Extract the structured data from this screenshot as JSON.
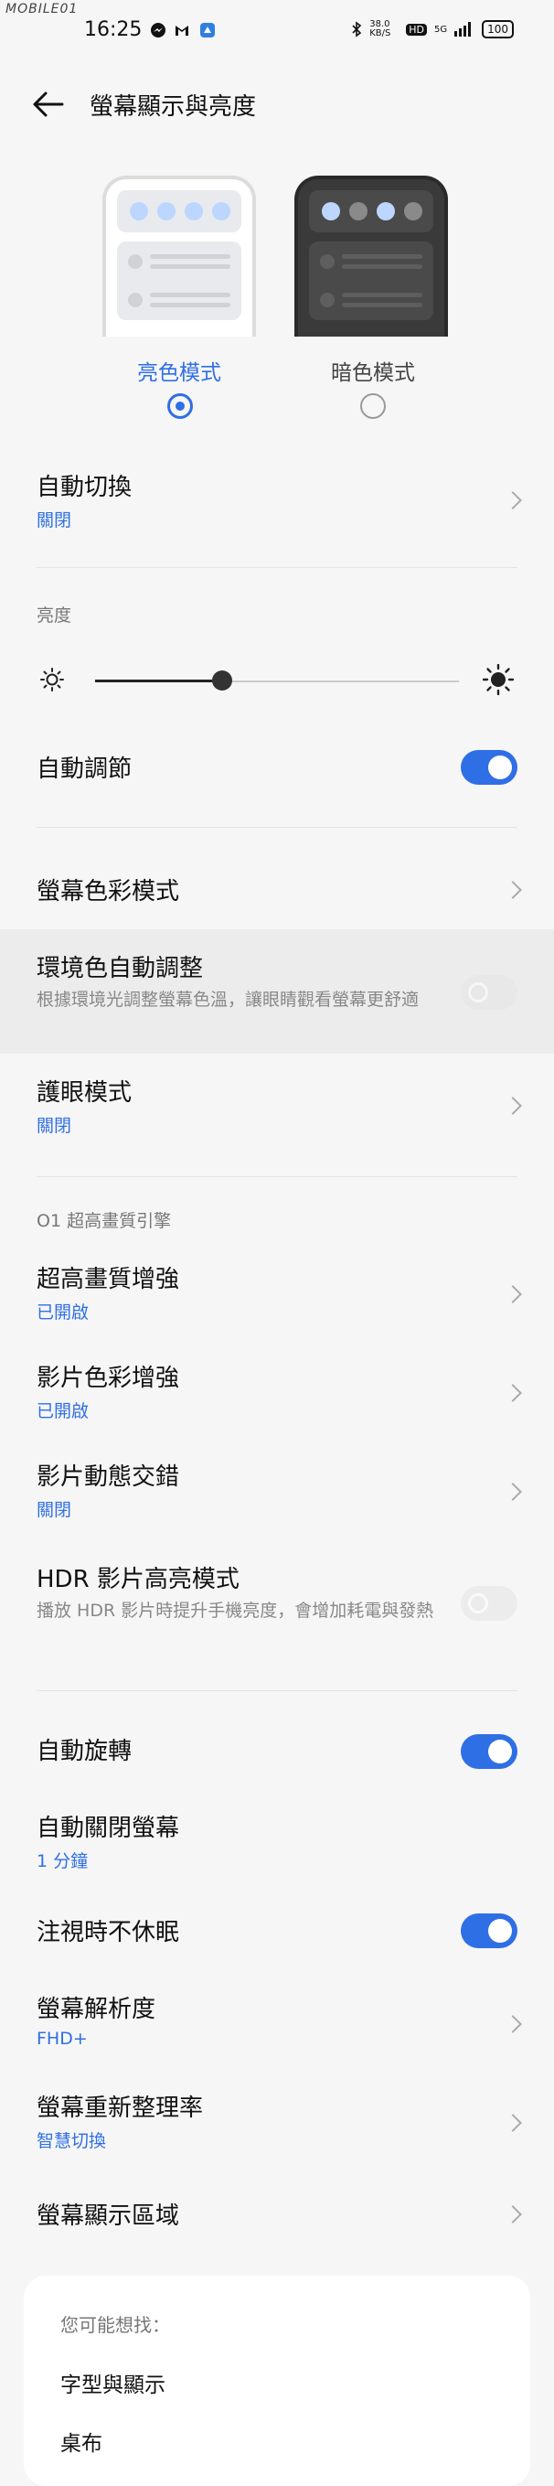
{
  "status_bar": {
    "watermark": "MOBILE01",
    "time": "16:25",
    "net_speed": "38.0 KB/S",
    "hd": "HD",
    "signal": "5G",
    "battery": "100"
  },
  "header": {
    "title": "螢幕顯示與亮度"
  },
  "theme": {
    "light_label": "亮色模式",
    "dark_label": "暗色模式",
    "selected": "light"
  },
  "auto_switch": {
    "title": "自動切換",
    "value": "關閉"
  },
  "brightness": {
    "label": "亮度",
    "level_fraction": 0.35
  },
  "auto_adjust": {
    "title": "自動調節",
    "enabled": true
  },
  "color_mode": {
    "title": "螢幕色彩模式"
  },
  "ambient": {
    "title": "環境色自動調整",
    "desc": "根據環境光調整螢幕色溫，讓眼睛觀看螢幕更舒適",
    "enabled": false
  },
  "eye_care": {
    "title": "護眼模式",
    "value": "關閉"
  },
  "section_engine": {
    "label": "O1 超高畫質引擎"
  },
  "ultra_hd": {
    "title": "超高畫質增強",
    "value": "已開啟"
  },
  "video_color": {
    "title": "影片色彩增強",
    "value": "已開啟"
  },
  "video_motion": {
    "title": "影片動態交錯",
    "value": "關閉"
  },
  "hdr": {
    "title": "HDR 影片高亮模式",
    "desc": "播放 HDR 影片時提升手機亮度，會增加耗電與發熱",
    "enabled": false
  },
  "auto_rotate": {
    "title": "自動旋轉",
    "enabled": true
  },
  "screen_timeout": {
    "title": "自動關閉螢幕",
    "value": "1 分鐘"
  },
  "stay_awake": {
    "title": "注視時不休眠",
    "enabled": true
  },
  "resolution": {
    "title": "螢幕解析度",
    "value": "FHD+"
  },
  "refresh_rate": {
    "title": "螢幕重新整理率",
    "value": "智慧切換"
  },
  "display_area": {
    "title": "螢幕顯示區域"
  },
  "suggestions": {
    "label": "您可能想找：",
    "items": [
      "字型與顯示",
      "桌布"
    ]
  },
  "colors": {
    "accent": "#2f6fe5",
    "background": "#f6f6f6",
    "dot_blue": "#bcd6ff"
  }
}
